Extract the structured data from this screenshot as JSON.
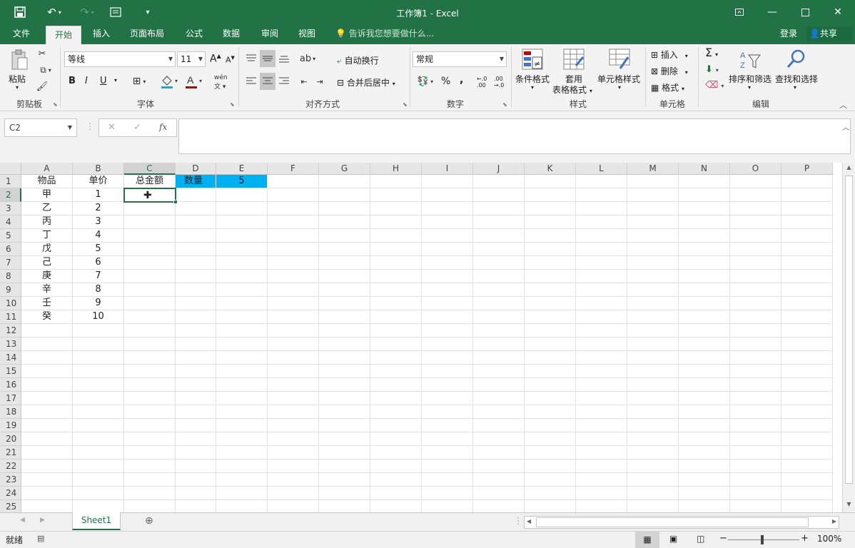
{
  "window": {
    "title": "工作簿1 - Excel",
    "icons": [
      "save-icon",
      "undo-icon",
      "redo-icon",
      "form-icon",
      "customize-icon",
      "ribbon-display-icon",
      "minimize-icon",
      "maximize-icon",
      "close-icon"
    ]
  },
  "tabs": [
    "文件",
    "开始",
    "插入",
    "页面布局",
    "公式",
    "数据",
    "审阅",
    "视图"
  ],
  "active_tab": "开始",
  "tellme": "告诉我您想要做什么...",
  "account": {
    "login": "登录",
    "share": "共享"
  },
  "ribbon": {
    "clipboard": {
      "paste": "粘贴",
      "label": "剪贴板"
    },
    "font": {
      "name": "等线",
      "size": "11",
      "bold": "B",
      "italic": "I",
      "underline": "U",
      "label": "字体",
      "grow": "A",
      "shrink": "A",
      "wen": "wén"
    },
    "alignment": {
      "wrap": "自动换行",
      "merge": "合并后居中",
      "label": "对齐方式"
    },
    "number": {
      "format": "常规",
      "label": "数字",
      "percent": "%",
      "comma": ",",
      "inc": "←.0 .00",
      "dec": ".00 →.0"
    },
    "styles": {
      "conditional": "条件格式",
      "table_line1": "套用",
      "table_line2": "表格格式",
      "cell_styles": "单元格样式",
      "label": "样式"
    },
    "cells": {
      "insert": "插入",
      "delete": "删除",
      "format": "格式",
      "label": "单元格"
    },
    "editing": {
      "sort": "排序和筛选",
      "find": "查找和选择",
      "label": "编辑"
    }
  },
  "formula_bar": {
    "name_box": "C2",
    "fx": "fx",
    "value": ""
  },
  "columns": [
    "A",
    "B",
    "C",
    "D",
    "E",
    "F",
    "G",
    "H",
    "I",
    "J",
    "K",
    "L",
    "M",
    "N",
    "O",
    "P"
  ],
  "selected_column": "C",
  "selected_row": "2",
  "rows": [
    "1",
    "2",
    "3",
    "4",
    "5",
    "6",
    "7",
    "8",
    "9",
    "10",
    "11",
    "12",
    "13",
    "14",
    "15",
    "16",
    "17",
    "18",
    "19",
    "20",
    "21",
    "22",
    "23",
    "24",
    "25"
  ],
  "cells": {
    "A1": "物品",
    "B1": "单价",
    "C1": "总金额",
    "D1": "数量",
    "E1": "5",
    "A2": "甲",
    "B2": "1",
    "A3": "乙",
    "B3": "2",
    "A4": "丙",
    "B4": "3",
    "A5": "丁",
    "B5": "4",
    "A6": "戊",
    "B6": "5",
    "A7": "己",
    "B7": "6",
    "A8": "庚",
    "B8": "7",
    "A9": "辛",
    "B9": "8",
    "A10": "壬",
    "B10": "9",
    "A11": "癸",
    "B11": "10"
  },
  "highlight_color": "#00b0f0",
  "accent_color": "#217346",
  "sheet": {
    "name": "Sheet1"
  },
  "status": {
    "ready": "就绪",
    "zoom": "100%"
  }
}
